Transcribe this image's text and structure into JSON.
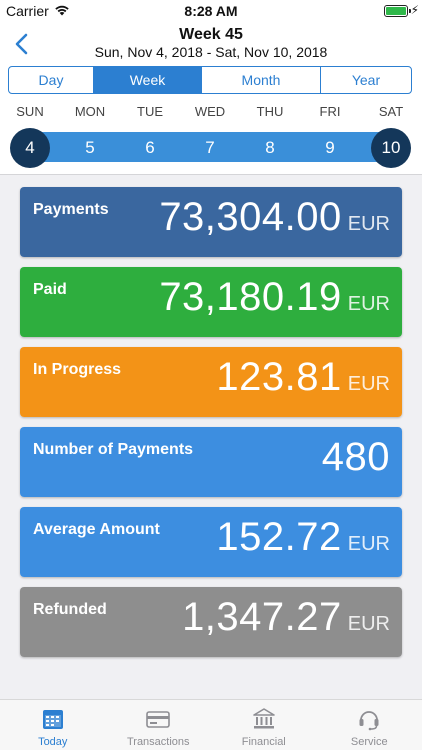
{
  "status_bar": {
    "carrier": "Carrier",
    "time": "8:28 AM"
  },
  "header": {
    "title": "Week 45",
    "subtitle": "Sun, Nov 4, 2018 - Sat, Nov 10, 2018"
  },
  "segments": [
    {
      "label": "Day",
      "active": false
    },
    {
      "label": "Week",
      "active": true
    },
    {
      "label": "Month",
      "active": false
    },
    {
      "label": "Year",
      "active": false
    }
  ],
  "weekdays": [
    "SUN",
    "MON",
    "TUE",
    "WED",
    "THU",
    "FRI",
    "SAT"
  ],
  "dates": [
    "4",
    "5",
    "6",
    "7",
    "8",
    "9",
    "10"
  ],
  "cards": [
    {
      "label": "Payments",
      "value": "73,304.00",
      "unit": "EUR",
      "color": "#3a679f"
    },
    {
      "label": "Paid",
      "value": "73,180.19",
      "unit": "EUR",
      "color": "#2eae3e"
    },
    {
      "label": "In Progress",
      "value": "123.81",
      "unit": "EUR",
      "color": "#f39317"
    },
    {
      "label": "Number of Payments",
      "value": "480",
      "unit": "",
      "color": "#3d8ee0"
    },
    {
      "label": "Average Amount",
      "value": "152.72",
      "unit": "EUR",
      "color": "#3d8ee0"
    },
    {
      "label": "Refunded",
      "value": "1,347.27",
      "unit": "EUR",
      "color": "#8e8e8e"
    }
  ],
  "tabs": [
    {
      "label": "Today",
      "icon": "calendar-icon",
      "active": true
    },
    {
      "label": "Transactions",
      "icon": "card-icon",
      "active": false
    },
    {
      "label": "Financial",
      "icon": "bank-icon",
      "active": false
    },
    {
      "label": "Service",
      "icon": "headset-icon",
      "active": false
    }
  ],
  "colors": {
    "accent": "#2c7fd1",
    "endpoint": "#14375a",
    "strip": "#3a8fd9"
  }
}
